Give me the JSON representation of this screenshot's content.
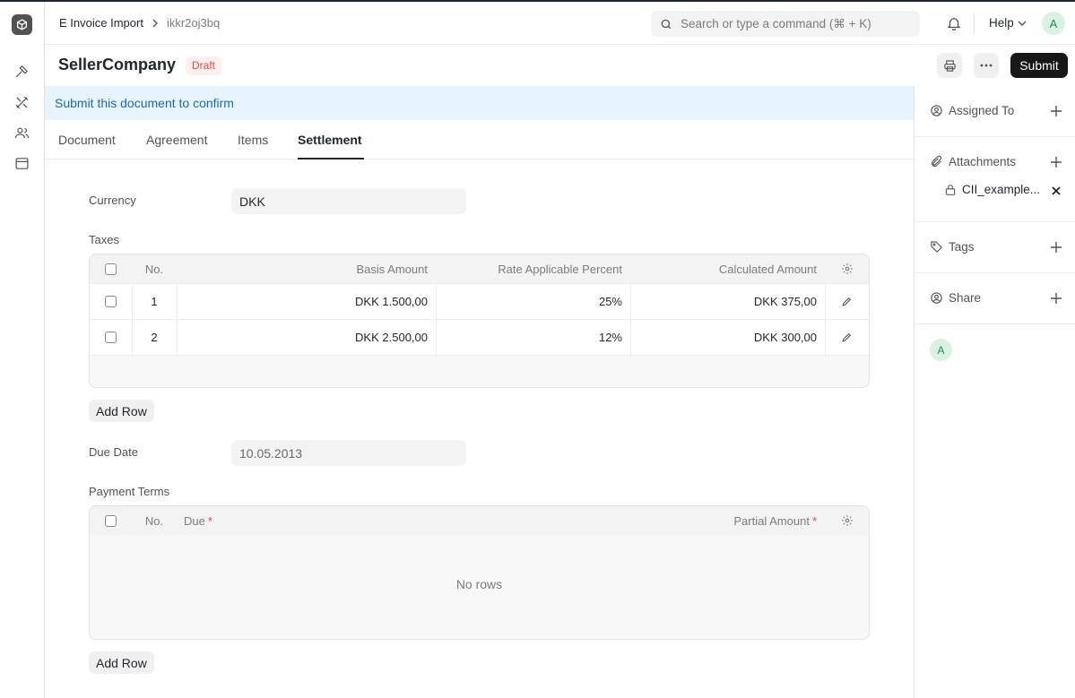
{
  "breadcrumb": {
    "doctype": "E Invoice Import",
    "docname": "ikkr2oj3bq"
  },
  "search": {
    "placeholder": "Search or type a command (⌘ + K)"
  },
  "navbar": {
    "help_label": "Help",
    "avatar_initial": "A"
  },
  "page": {
    "title": "SellerCompany",
    "status": "Draft",
    "submit_label": "Submit"
  },
  "alert": {
    "text": "Submit this document to confirm"
  },
  "tabs": [
    {
      "label": "Document"
    },
    {
      "label": "Agreement"
    },
    {
      "label": "Items"
    },
    {
      "label": "Settlement",
      "active": true
    }
  ],
  "form": {
    "currency": {
      "label": "Currency",
      "value": "DKK"
    },
    "taxes": {
      "label": "Taxes",
      "headers": {
        "no": "No.",
        "basis": "Basis Amount",
        "rate": "Rate Applicable Percent",
        "calculated": "Calculated Amount"
      },
      "rows": [
        {
          "no": "1",
          "basis": "DKK 1.500,00",
          "rate": "25%",
          "calculated": "DKK 375,00"
        },
        {
          "no": "2",
          "basis": "DKK 2.500,00",
          "rate": "12%",
          "calculated": "DKK 300,00"
        }
      ],
      "add_row_label": "Add Row"
    },
    "due_date": {
      "label": "Due Date",
      "value": "10.05.2013"
    },
    "payment_terms": {
      "label": "Payment Terms",
      "headers": {
        "no": "No.",
        "due": "Due",
        "partial": "Partial Amount",
        "required_mark": "*"
      },
      "empty_text": "No rows",
      "add_row_label": "Add Row"
    }
  },
  "sidebar": {
    "assigned_to": "Assigned To",
    "attachments": "Attachments",
    "attachment_file": "CII_example...",
    "tags": "Tags",
    "share": "Share",
    "viewer_initial": "A"
  },
  "colors": {
    "accent": "#171717",
    "draft_badge": "#e24c4c",
    "alert_bg": "#e8f4fd",
    "alert_text": "#1e6aa8"
  }
}
